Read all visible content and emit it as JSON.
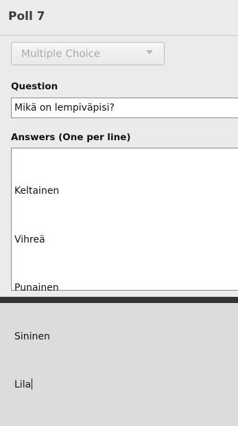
{
  "poll": {
    "title": "Poll 7"
  },
  "dropdown": {
    "selected": "Multiple Choice",
    "icon": "chevron-down-icon"
  },
  "question": {
    "label": "Question",
    "value": "Mikä on lempiväрisi?"
  },
  "answers": {
    "label": "Answers (One per line)",
    "items": [
      "Keltainen",
      "Vihreä",
      "Punainen",
      "Sininen",
      "Lila"
    ]
  }
}
